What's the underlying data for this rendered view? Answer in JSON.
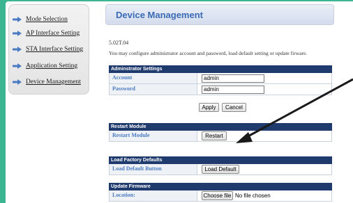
{
  "sidebar": {
    "items": [
      {
        "label": "Mode Selection"
      },
      {
        "label": "AP Interface Setting"
      },
      {
        "label": "STA Interface Setting"
      },
      {
        "label": "Application Setting"
      },
      {
        "label": "Device Management"
      }
    ]
  },
  "header": {
    "title": "Device Management"
  },
  "info": {
    "version": "5.02T.04",
    "description": "You may configure administrator account and password, load default setting or update firware."
  },
  "admin": {
    "heading": "Adminstrator Settings",
    "account_label": "Account",
    "account_value": "admin",
    "password_label": "Password",
    "password_value": "admin",
    "apply_label": "Apply",
    "cancel_label": "Cancel"
  },
  "restart": {
    "heading": "Restart Module",
    "row_label": "Restart Module",
    "button_label": "Restart"
  },
  "factory": {
    "heading": "Load Factory Defaults",
    "row_label": "Load Default Button",
    "button_label": "Load Default"
  },
  "firmware": {
    "heading": "Update Firmware",
    "row_label": "Location:",
    "choose_label": "Choose file",
    "status_text": "No file chosen"
  },
  "colors": {
    "background": "#3bb592",
    "accent": "#3a6ab4",
    "section_header": "#1f3b6e"
  }
}
